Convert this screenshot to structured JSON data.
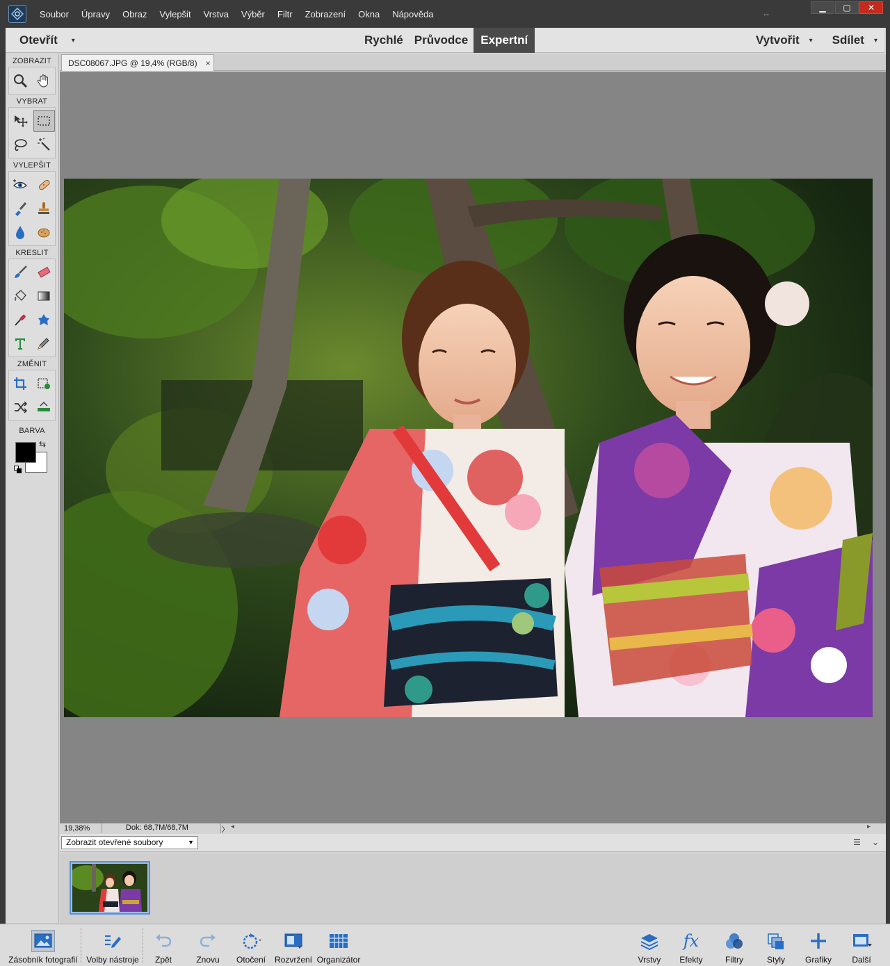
{
  "menubar": {
    "items": [
      "Soubor",
      "Úpravy",
      "Obraz",
      "Vylepšit",
      "Vrstva",
      "Výběr",
      "Filtr",
      "Zobrazení",
      "Okna",
      "Nápověda"
    ],
    "resize_glyph": "↔",
    "window_controls": {
      "minimize": "▁",
      "maximize": "▢",
      "close": "✕"
    }
  },
  "modebar": {
    "open_label": "Otevřít",
    "caret": "▾",
    "modes": [
      "Rychlé",
      "Průvodce",
      "Expertní"
    ],
    "active_mode": "Expertní",
    "create_label": "Vytvořit",
    "share_label": "Sdílet"
  },
  "toolbox": {
    "sections": {
      "view": "ZOBRAZIT",
      "select": "VYBRAT",
      "enhance": "VYLEPŠIT",
      "draw": "KRESLIT",
      "modify": "ZMĚNIT",
      "color": "BARVA"
    },
    "tools": {
      "view": [
        "zoom-icon",
        "hand-icon"
      ],
      "select": [
        "move-icon",
        "marquee-icon",
        "lasso-icon",
        "magic-wand-icon"
      ],
      "enhance": [
        "red-eye-icon",
        "spot-healing-icon",
        "smart-brush-icon",
        "clone-stamp-icon",
        "blur-icon",
        "sponge-icon"
      ],
      "draw": [
        "brush-icon",
        "eraser-icon",
        "paint-bucket-icon",
        "gradient-icon",
        "eyedropper-icon",
        "custom-shape-icon",
        "type-icon",
        "pencil-icon"
      ],
      "modify": [
        "crop-icon",
        "recompose-icon",
        "content-aware-move-icon",
        "straighten-icon"
      ]
    },
    "selected_tool": "marquee-icon",
    "colors": {
      "foreground": "#000000",
      "background": "#ffffff"
    },
    "swap_glyph": "⇆"
  },
  "document": {
    "tab_title": "DSC08067.JPG @ 19,4% (RGB/8)",
    "tab_close": "×"
  },
  "status": {
    "zoom": "19,38%",
    "doc_info": "Dok: 68,7M/68,7M",
    "arrow": "〉",
    "scroll_left": "◂",
    "scroll_right": "▸"
  },
  "photo_bin": {
    "dropdown_value": "Zobrazit otevřené soubory",
    "dropdown_caret": "▼",
    "options_icon": "☰",
    "collapse_icon": "⌄"
  },
  "taskbar": {
    "left": [
      {
        "label": "Zásobník fotografií",
        "icon": "photo-bin-icon",
        "active": true
      },
      {
        "label": "Volby nástroje",
        "icon": "tool-options-icon"
      },
      {
        "label": "Zpět",
        "icon": "undo-icon"
      },
      {
        "label": "Znovu",
        "icon": "redo-icon"
      },
      {
        "label": "Otočení",
        "icon": "rotate-icon"
      },
      {
        "label": "Rozvržení",
        "icon": "layout-icon"
      },
      {
        "label": "Organizátor",
        "icon": "organizer-icon"
      }
    ],
    "right": [
      {
        "label": "Vrstvy",
        "icon": "layers-icon"
      },
      {
        "label": "Efekty",
        "icon": "effects-icon"
      },
      {
        "label": "Filtry",
        "icon": "filters-icon"
      },
      {
        "label": "Styly",
        "icon": "styles-icon"
      },
      {
        "label": "Grafiky",
        "icon": "graphics-icon"
      },
      {
        "label": "Další",
        "icon": "more-icon"
      }
    ],
    "effects_glyph": "fx"
  },
  "colors": {
    "accent_blue": "#2a6ec4",
    "titlebar": "#3a3a3a",
    "canvas_gray": "#858585",
    "active_mode_bg": "#4a4a4a"
  }
}
